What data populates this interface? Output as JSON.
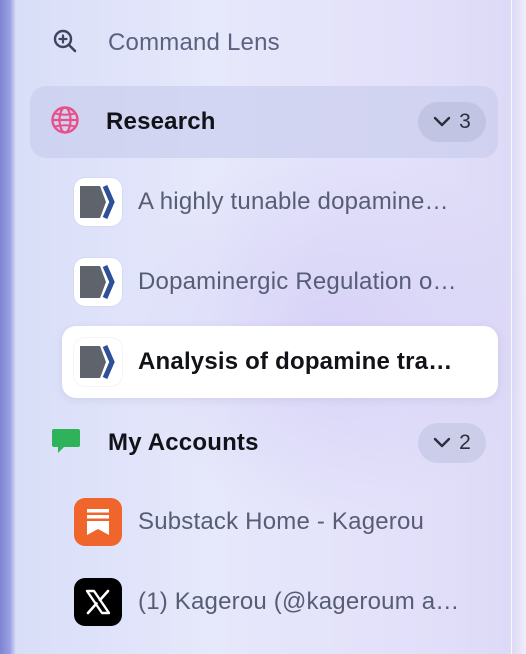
{
  "command_lens": {
    "label": "Command Lens",
    "icon": "zoom-in-icon"
  },
  "groups": [
    {
      "label": "Research",
      "icon": "globe-icon",
      "icon_color": "#e8508c",
      "count": "3",
      "items": [
        {
          "label": "A highly tunable dopamine…",
          "icon": "document-chevron-icon"
        },
        {
          "label": "Dopaminergic Regulation o…",
          "icon": "document-chevron-icon"
        },
        {
          "label": "Analysis of dopamine tra…",
          "icon": "document-chevron-icon",
          "active": true
        }
      ]
    },
    {
      "label": "My Accounts",
      "icon": "chat-bubble-icon",
      "icon_color": "#2fb35a",
      "count": "2",
      "items": [
        {
          "label": "Substack Home - Kagerou",
          "icon": "substack-icon"
        },
        {
          "label": "(1) Kagerou (@kageroum a…",
          "icon": "x-logo-icon"
        }
      ]
    }
  ],
  "colors": {
    "accent_orange": "#f0652b",
    "doc_dark": "#5f636b",
    "doc_blue": "#2f4f9b"
  }
}
